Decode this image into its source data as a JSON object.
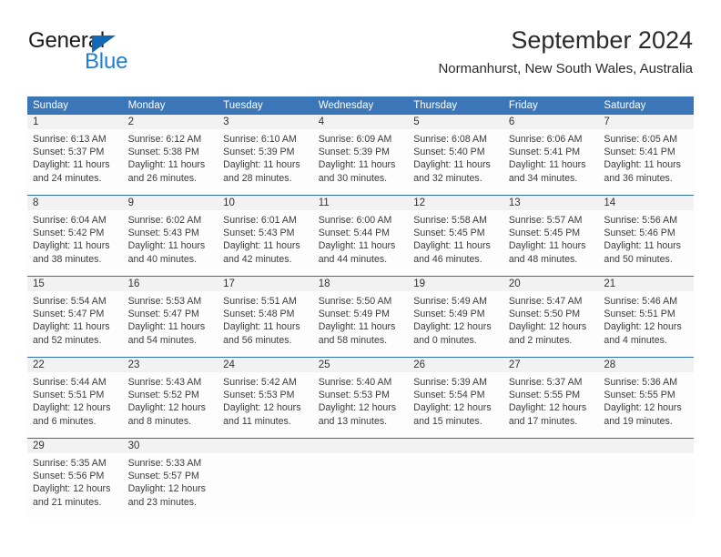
{
  "brand": {
    "name_part1": "General",
    "name_part2": "Blue",
    "triangle_color": "#1268b3",
    "blue_text_color": "#1f7fd4"
  },
  "header": {
    "title": "September 2024",
    "subtitle": "Normanhurst, New South Wales, Australia"
  },
  "theme": {
    "header_band": "#3a76b8",
    "daynum_band": "#f2f2f2",
    "separator": "#2f6fae",
    "cell_bg": "#fdfdfd",
    "text": "#3b3b3b"
  },
  "calendar": {
    "weekday_headers": [
      "Sunday",
      "Monday",
      "Tuesday",
      "Wednesday",
      "Thursday",
      "Friday",
      "Saturday"
    ],
    "weeks": [
      [
        {
          "day": "1",
          "sunrise": "Sunrise: 6:13 AM",
          "sunset": "Sunset: 5:37 PM",
          "daylight_1": "Daylight: 11 hours",
          "daylight_2": "and 24 minutes."
        },
        {
          "day": "2",
          "sunrise": "Sunrise: 6:12 AM",
          "sunset": "Sunset: 5:38 PM",
          "daylight_1": "Daylight: 11 hours",
          "daylight_2": "and 26 minutes."
        },
        {
          "day": "3",
          "sunrise": "Sunrise: 6:10 AM",
          "sunset": "Sunset: 5:39 PM",
          "daylight_1": "Daylight: 11 hours",
          "daylight_2": "and 28 minutes."
        },
        {
          "day": "4",
          "sunrise": "Sunrise: 6:09 AM",
          "sunset": "Sunset: 5:39 PM",
          "daylight_1": "Daylight: 11 hours",
          "daylight_2": "and 30 minutes."
        },
        {
          "day": "5",
          "sunrise": "Sunrise: 6:08 AM",
          "sunset": "Sunset: 5:40 PM",
          "daylight_1": "Daylight: 11 hours",
          "daylight_2": "and 32 minutes."
        },
        {
          "day": "6",
          "sunrise": "Sunrise: 6:06 AM",
          "sunset": "Sunset: 5:41 PM",
          "daylight_1": "Daylight: 11 hours",
          "daylight_2": "and 34 minutes."
        },
        {
          "day": "7",
          "sunrise": "Sunrise: 6:05 AM",
          "sunset": "Sunset: 5:41 PM",
          "daylight_1": "Daylight: 11 hours",
          "daylight_2": "and 36 minutes."
        }
      ],
      [
        {
          "day": "8",
          "sunrise": "Sunrise: 6:04 AM",
          "sunset": "Sunset: 5:42 PM",
          "daylight_1": "Daylight: 11 hours",
          "daylight_2": "and 38 minutes."
        },
        {
          "day": "9",
          "sunrise": "Sunrise: 6:02 AM",
          "sunset": "Sunset: 5:43 PM",
          "daylight_1": "Daylight: 11 hours",
          "daylight_2": "and 40 minutes."
        },
        {
          "day": "10",
          "sunrise": "Sunrise: 6:01 AM",
          "sunset": "Sunset: 5:43 PM",
          "daylight_1": "Daylight: 11 hours",
          "daylight_2": "and 42 minutes."
        },
        {
          "day": "11",
          "sunrise": "Sunrise: 6:00 AM",
          "sunset": "Sunset: 5:44 PM",
          "daylight_1": "Daylight: 11 hours",
          "daylight_2": "and 44 minutes."
        },
        {
          "day": "12",
          "sunrise": "Sunrise: 5:58 AM",
          "sunset": "Sunset: 5:45 PM",
          "daylight_1": "Daylight: 11 hours",
          "daylight_2": "and 46 minutes."
        },
        {
          "day": "13",
          "sunrise": "Sunrise: 5:57 AM",
          "sunset": "Sunset: 5:45 PM",
          "daylight_1": "Daylight: 11 hours",
          "daylight_2": "and 48 minutes."
        },
        {
          "day": "14",
          "sunrise": "Sunrise: 5:56 AM",
          "sunset": "Sunset: 5:46 PM",
          "daylight_1": "Daylight: 11 hours",
          "daylight_2": "and 50 minutes."
        }
      ],
      [
        {
          "day": "15",
          "sunrise": "Sunrise: 5:54 AM",
          "sunset": "Sunset: 5:47 PM",
          "daylight_1": "Daylight: 11 hours",
          "daylight_2": "and 52 minutes."
        },
        {
          "day": "16",
          "sunrise": "Sunrise: 5:53 AM",
          "sunset": "Sunset: 5:47 PM",
          "daylight_1": "Daylight: 11 hours",
          "daylight_2": "and 54 minutes."
        },
        {
          "day": "17",
          "sunrise": "Sunrise: 5:51 AM",
          "sunset": "Sunset: 5:48 PM",
          "daylight_1": "Daylight: 11 hours",
          "daylight_2": "and 56 minutes."
        },
        {
          "day": "18",
          "sunrise": "Sunrise: 5:50 AM",
          "sunset": "Sunset: 5:49 PM",
          "daylight_1": "Daylight: 11 hours",
          "daylight_2": "and 58 minutes."
        },
        {
          "day": "19",
          "sunrise": "Sunrise: 5:49 AM",
          "sunset": "Sunset: 5:49 PM",
          "daylight_1": "Daylight: 12 hours",
          "daylight_2": "and 0 minutes."
        },
        {
          "day": "20",
          "sunrise": "Sunrise: 5:47 AM",
          "sunset": "Sunset: 5:50 PM",
          "daylight_1": "Daylight: 12 hours",
          "daylight_2": "and 2 minutes."
        },
        {
          "day": "21",
          "sunrise": "Sunrise: 5:46 AM",
          "sunset": "Sunset: 5:51 PM",
          "daylight_1": "Daylight: 12 hours",
          "daylight_2": "and 4 minutes."
        }
      ],
      [
        {
          "day": "22",
          "sunrise": "Sunrise: 5:44 AM",
          "sunset": "Sunset: 5:51 PM",
          "daylight_1": "Daylight: 12 hours",
          "daylight_2": "and 6 minutes."
        },
        {
          "day": "23",
          "sunrise": "Sunrise: 5:43 AM",
          "sunset": "Sunset: 5:52 PM",
          "daylight_1": "Daylight: 12 hours",
          "daylight_2": "and 8 minutes."
        },
        {
          "day": "24",
          "sunrise": "Sunrise: 5:42 AM",
          "sunset": "Sunset: 5:53 PM",
          "daylight_1": "Daylight: 12 hours",
          "daylight_2": "and 11 minutes."
        },
        {
          "day": "25",
          "sunrise": "Sunrise: 5:40 AM",
          "sunset": "Sunset: 5:53 PM",
          "daylight_1": "Daylight: 12 hours",
          "daylight_2": "and 13 minutes."
        },
        {
          "day": "26",
          "sunrise": "Sunrise: 5:39 AM",
          "sunset": "Sunset: 5:54 PM",
          "daylight_1": "Daylight: 12 hours",
          "daylight_2": "and 15 minutes."
        },
        {
          "day": "27",
          "sunrise": "Sunrise: 5:37 AM",
          "sunset": "Sunset: 5:55 PM",
          "daylight_1": "Daylight: 12 hours",
          "daylight_2": "and 17 minutes."
        },
        {
          "day": "28",
          "sunrise": "Sunrise: 5:36 AM",
          "sunset": "Sunset: 5:55 PM",
          "daylight_1": "Daylight: 12 hours",
          "daylight_2": "and 19 minutes."
        }
      ],
      [
        {
          "day": "29",
          "sunrise": "Sunrise: 5:35 AM",
          "sunset": "Sunset: 5:56 PM",
          "daylight_1": "Daylight: 12 hours",
          "daylight_2": "and 21 minutes."
        },
        {
          "day": "30",
          "sunrise": "Sunrise: 5:33 AM",
          "sunset": "Sunset: 5:57 PM",
          "daylight_1": "Daylight: 12 hours",
          "daylight_2": "and 23 minutes."
        },
        {
          "day": "",
          "sunrise": "",
          "sunset": "",
          "daylight_1": "",
          "daylight_2": ""
        },
        {
          "day": "",
          "sunrise": "",
          "sunset": "",
          "daylight_1": "",
          "daylight_2": ""
        },
        {
          "day": "",
          "sunrise": "",
          "sunset": "",
          "daylight_1": "",
          "daylight_2": ""
        },
        {
          "day": "",
          "sunrise": "",
          "sunset": "",
          "daylight_1": "",
          "daylight_2": ""
        },
        {
          "day": "",
          "sunrise": "",
          "sunset": "",
          "daylight_1": "",
          "daylight_2": ""
        }
      ]
    ]
  }
}
